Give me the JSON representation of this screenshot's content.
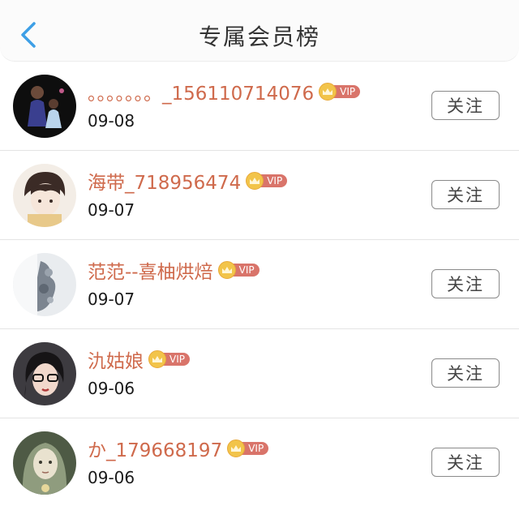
{
  "header": {
    "title": "专属会员榜",
    "back_icon": "chevron-left-icon",
    "accent": "#3d9fe6"
  },
  "colors": {
    "name": "#cf6a4c",
    "vip_tag": "#d9746a",
    "crown": "#f2c44a"
  },
  "members": [
    {
      "name": "。。。。。。。_156110714076",
      "date": "09-08",
      "vip": "VIP",
      "follow": "关注"
    },
    {
      "name": "海带_718956474",
      "date": "09-07",
      "vip": "VIP",
      "follow": "关注"
    },
    {
      "name": "范范--喜柚烘焙",
      "date": "09-07",
      "vip": "VIP",
      "follow": "关注"
    },
    {
      "name": "氿姑娘",
      "date": "09-06",
      "vip": "VIP",
      "follow": "关注"
    },
    {
      "name": "か_179668197",
      "date": "09-06",
      "vip": "VIP",
      "follow": "关注"
    }
  ]
}
